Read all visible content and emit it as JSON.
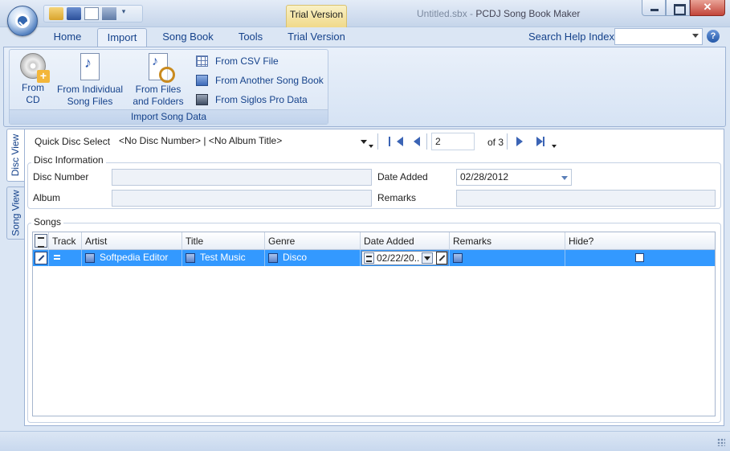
{
  "app": {
    "title_doc": "Untitled.sbx",
    "title_sep": " - ",
    "title_app": "PCDJ Song Book Maker",
    "trial_tab": "Trial Version"
  },
  "ribbon": {
    "tabs": [
      "Home",
      "Import",
      "Song Book",
      "Tools",
      "Trial Version"
    ],
    "active_tab": "Import",
    "search_help_label": "Search Help Index",
    "search_help_value": ""
  },
  "import_group": {
    "label": "Import Song Data",
    "from_cd": [
      "From",
      "CD"
    ],
    "from_individual": [
      "From Individual",
      "Song Files"
    ],
    "from_files": [
      "From Files",
      "and Folders"
    ],
    "from_csv": "From CSV File",
    "from_songbook": "From Another Song Book",
    "from_siglos": "From Siglos Pro Data"
  },
  "side_tabs": [
    "Disc View",
    "Song View"
  ],
  "navbar": {
    "quick_disc_label": "Quick Disc Select",
    "quick_disc_value": "<No Disc Number> | <No Album Title>",
    "position": "2",
    "of_label": "of 3"
  },
  "disc_info": {
    "title": "Disc Information",
    "disc_number_label": "Disc Number",
    "disc_number_value": "",
    "album_label": "Album",
    "album_value": "",
    "date_added_label": "Date Added",
    "date_added_value": "02/28/2012",
    "remarks_label": "Remarks",
    "remarks_value": ""
  },
  "songs": {
    "title": "Songs",
    "columns": [
      "Track",
      "Artist",
      "Title",
      "Genre",
      "Date Added",
      "Remarks",
      "Hide?"
    ],
    "rows": [
      {
        "track": "",
        "artist": "Softpedia Editor",
        "title": "Test Music",
        "genre": "Disco",
        "date_added": "02/22/20..",
        "remarks": "",
        "hide": false
      }
    ]
  },
  "colors": {
    "selection": "#3399ff",
    "ribbon_text": "#15428b",
    "window_bg": "#dbe6f4"
  }
}
